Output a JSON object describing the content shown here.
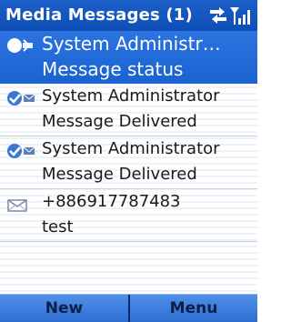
{
  "titlebar": {
    "title": "Media Messages (1)",
    "icons": [
      "data-connection-icon",
      "signal-strength-icon"
    ]
  },
  "messages": [
    {
      "sender": "System Administr…",
      "subject": "Message status",
      "icon": "unread-status-icon",
      "selected": true
    },
    {
      "sender": "System Administrator",
      "subject": "Message Delivered",
      "icon": "delivered-status-icon",
      "selected": false
    },
    {
      "sender": "System Administrator",
      "subject": "Message Delivered",
      "icon": "delivered-status-icon",
      "selected": false
    },
    {
      "sender": "+886917787483",
      "subject": "test",
      "icon": "envelope-icon",
      "selected": false
    }
  ],
  "softkeys": {
    "left": "New",
    "right": "Menu"
  },
  "colors": {
    "title_bar": "#1b5fc8",
    "selection": "#2b74e0",
    "softkey_bar": "#3d7ddc"
  }
}
